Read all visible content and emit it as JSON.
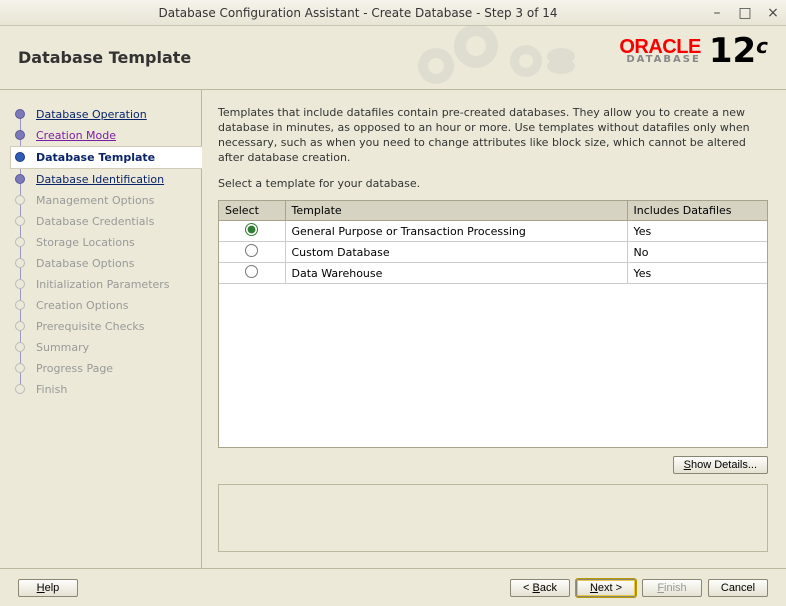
{
  "window": {
    "title": "Database Configuration Assistant - Create Database - Step 3 of 14"
  },
  "header": {
    "page_title": "Database Template",
    "brand": "ORACLE",
    "brand_sub": "DATABASE",
    "version": "12",
    "version_suffix": "c"
  },
  "sidebar": {
    "items": [
      {
        "label": "Database Operation",
        "state": "completed"
      },
      {
        "label": "Creation Mode",
        "state": "completed purple"
      },
      {
        "label": "Database Template",
        "state": "current"
      },
      {
        "label": "Database Identification",
        "state": "completed"
      },
      {
        "label": "Management Options",
        "state": "pending"
      },
      {
        "label": "Database Credentials",
        "state": "pending"
      },
      {
        "label": "Storage Locations",
        "state": "pending"
      },
      {
        "label": "Database Options",
        "state": "pending"
      },
      {
        "label": "Initialization Parameters",
        "state": "pending"
      },
      {
        "label": "Creation Options",
        "state": "pending"
      },
      {
        "label": "Prerequisite Checks",
        "state": "pending"
      },
      {
        "label": "Summary",
        "state": "pending"
      },
      {
        "label": "Progress Page",
        "state": "pending"
      },
      {
        "label": "Finish",
        "state": "pending"
      }
    ]
  },
  "content": {
    "description": "Templates that include datafiles contain pre-created databases. They allow you to create a new database in minutes, as opposed to an hour or more. Use templates without datafiles only when necessary, such as when you need to change attributes like block size, which cannot be altered after database creation.",
    "subdescription": "Select a template for your database.",
    "columns": {
      "select": "Select",
      "template": "Template",
      "includes": "Includes Datafiles"
    },
    "rows": [
      {
        "template": "General Purpose or Transaction Processing",
        "includes": "Yes",
        "selected": true
      },
      {
        "template": "Custom Database",
        "includes": "No",
        "selected": false
      },
      {
        "template": "Data Warehouse",
        "includes": "Yes",
        "selected": false
      }
    ],
    "show_details": "Show Details..."
  },
  "footer": {
    "help": "Help",
    "back": "< Back",
    "next": "Next >",
    "finish": "Finish",
    "cancel": "Cancel"
  }
}
